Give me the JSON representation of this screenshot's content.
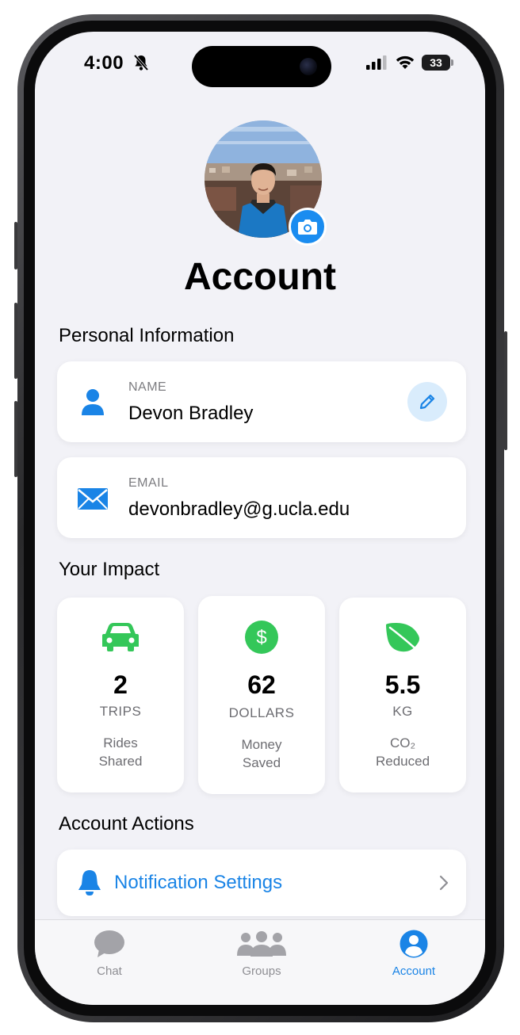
{
  "status_bar": {
    "time": "4:00",
    "battery": "33"
  },
  "page": {
    "title": "Account"
  },
  "personal": {
    "heading": "Personal Information",
    "name_label": "NAME",
    "name_value": "Devon Bradley",
    "email_label": "EMAIL",
    "email_value": "devonbradley@g.ucla.edu"
  },
  "impact": {
    "heading": "Your Impact",
    "stats": [
      {
        "value": "2",
        "unit": "TRIPS",
        "desc1": "Rides",
        "desc2": "Shared",
        "icon": "car-icon"
      },
      {
        "value": "62",
        "unit": "DOLLARS",
        "desc1": "Money",
        "desc2": "Saved",
        "icon": "dollar-icon"
      },
      {
        "value": "5.5",
        "unit": "KG",
        "desc1": "CO₂",
        "desc2": "Reduced",
        "icon": "leaf-icon"
      }
    ]
  },
  "actions": {
    "heading": "Account Actions",
    "notification_settings": "Notification Settings"
  },
  "tabbar": {
    "tabs": [
      {
        "label": "Chat",
        "icon": "chat-icon"
      },
      {
        "label": "Groups",
        "icon": "groups-icon"
      },
      {
        "label": "Account",
        "icon": "account-icon"
      }
    ],
    "active": "Account"
  },
  "colors": {
    "accent": "#1a84e6",
    "green": "#34c759",
    "background": "#f2f2f7"
  }
}
